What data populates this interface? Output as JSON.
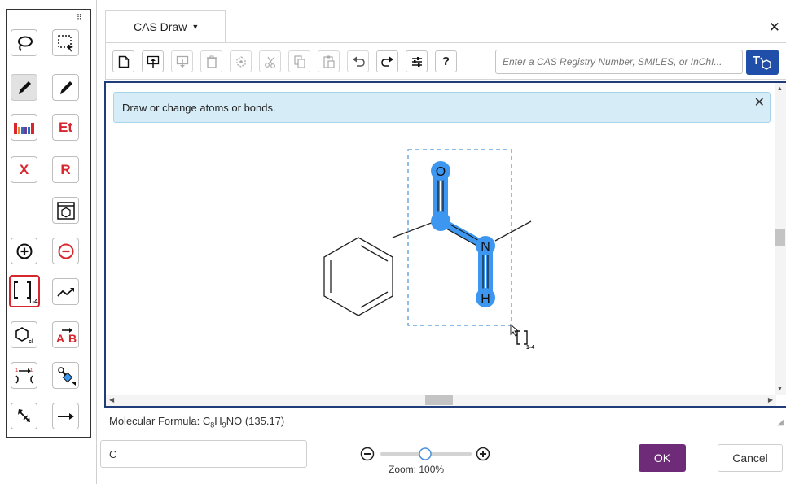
{
  "tab": {
    "title": "CAS Draw"
  },
  "toolbar": {
    "search_placeholder": "Enter a CAS Registry Number, SMILES, or InChI...",
    "help_label": "?",
    "search_button_icon": "structure-search-icon"
  },
  "palette": {
    "et_label": "Et",
    "x_label": "X",
    "r_label": "R",
    "bracket_range": "1-4",
    "ab_label": "A B"
  },
  "canvas": {
    "info_message": "Draw or change atoms or bonds.",
    "atom_labels": {
      "oxygen": "O",
      "nitrogen": "N",
      "hydrogen": "H"
    },
    "cursor_bracket_range": "1-4"
  },
  "footer": {
    "formula_label": "Molecular Formula: ",
    "formula_parts": [
      "C",
      "8",
      "H",
      "9",
      "NO"
    ],
    "mass": "(135.17)",
    "input_value": "C",
    "zoom_label": "Zoom: 100%",
    "zoom_percent": 100,
    "ok_label": "OK",
    "cancel_label": "Cancel"
  },
  "colors": {
    "selection": "#3d97f0",
    "primary_button": "#6d2b78",
    "search_button": "#1f4fa8",
    "highlight_tool": "#d7262d",
    "info_banner": "#d6edf8"
  }
}
